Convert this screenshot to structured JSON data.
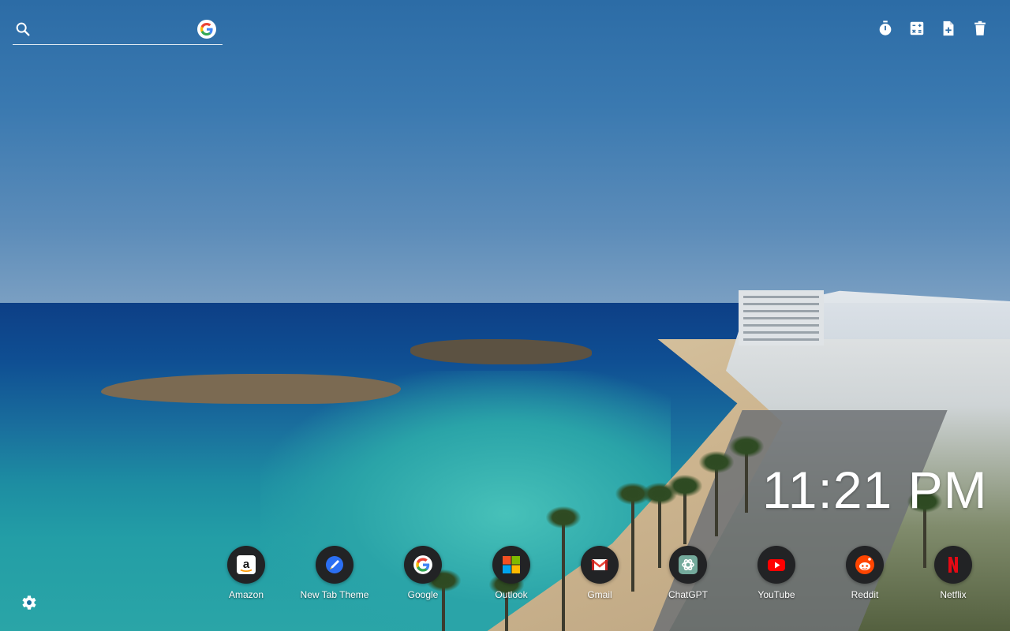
{
  "search": {
    "placeholder": "",
    "value": "",
    "engine_icon": "google-g-icon"
  },
  "toolbar": {
    "items": [
      {
        "icon": "timer-icon"
      },
      {
        "icon": "calculator-icon"
      },
      {
        "icon": "add-note-icon"
      },
      {
        "icon": "trash-icon"
      }
    ]
  },
  "clock": {
    "time": "11:21 PM"
  },
  "shortcuts": [
    {
      "label": "Amazon",
      "icon": "amazon-icon"
    },
    {
      "label": "New Tab Theme",
      "icon": "new-tab-theme-icon"
    },
    {
      "label": "Google",
      "icon": "google-icon"
    },
    {
      "label": "Outlook",
      "icon": "microsoft-icon"
    },
    {
      "label": "Gmail",
      "icon": "gmail-icon"
    },
    {
      "label": "ChatGPT",
      "icon": "chatgpt-icon"
    },
    {
      "label": "YouTube",
      "icon": "youtube-icon"
    },
    {
      "label": "Reddit",
      "icon": "reddit-icon"
    },
    {
      "label": "Netflix",
      "icon": "netflix-icon"
    }
  ],
  "settings": {
    "icon": "gear-icon"
  },
  "colors": {
    "text": "#ffffff",
    "shortcut_bg": "#222325"
  }
}
